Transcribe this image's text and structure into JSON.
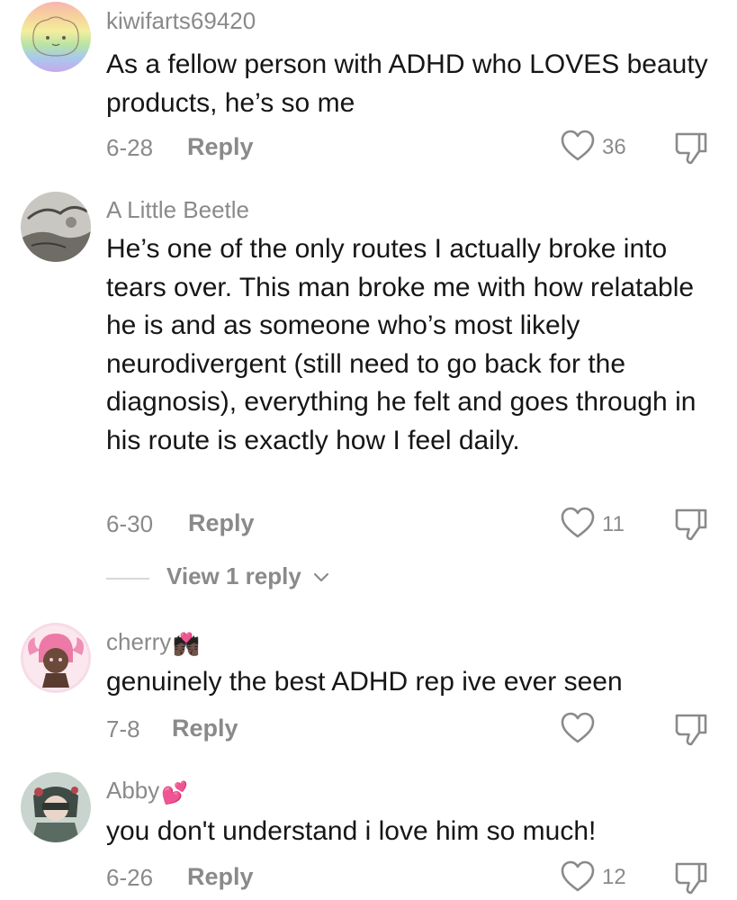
{
  "comments": [
    {
      "username": "kiwifarts69420",
      "username_emoji": "",
      "text": "As a fellow person with ADHD who LOVES beauty products, he’s so me",
      "date": "6-28",
      "reply_label": "Reply",
      "likes": "36"
    },
    {
      "username": "A Little Beetle",
      "username_emoji": "",
      "text": "He’s one of the only routes I actually broke into tears over. This man broke me with how relatable he is and as someone who’s most likely neurodivergent (still need to go back for the diagnosis), everything he felt and goes through in his route is exactly how I feel daily.",
      "date": "6-30",
      "reply_label": "Reply",
      "likes": "11",
      "view_replies_label": "View 1 reply"
    },
    {
      "username": "cherry",
      "username_emoji": "💏🏿",
      "text": "genuinely the best ADHD rep ive ever seen",
      "date": "7-8",
      "reply_label": "Reply",
      "likes": ""
    },
    {
      "username": "Abby",
      "username_emoji": "💕",
      "text": "you don't understand i love him so much!",
      "date": "6-26",
      "reply_label": "Reply",
      "likes": "12"
    }
  ],
  "icons": {
    "like": "heart-outline-icon",
    "dislike": "thumbs-down-icon",
    "expand": "chevron-down-icon"
  },
  "colors": {
    "text": "#161616",
    "muted": "#8a8a8a",
    "divider": "#d8d8d8"
  }
}
